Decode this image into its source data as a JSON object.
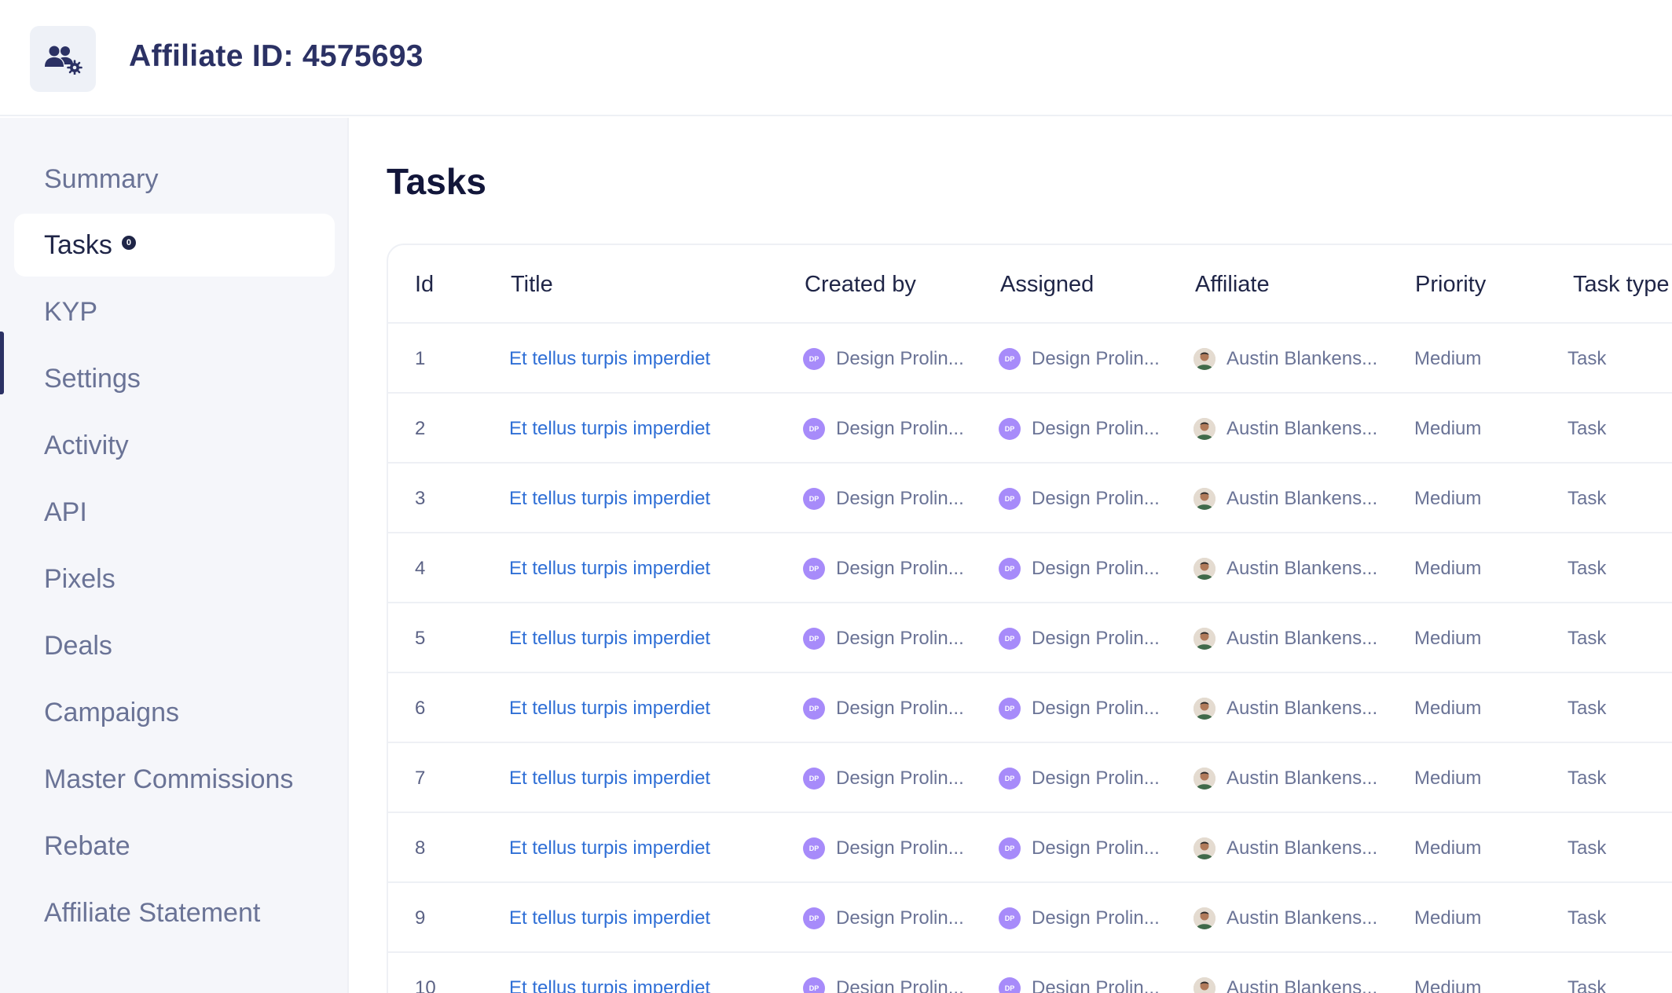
{
  "header": {
    "title": "Affiliate ID: 4575693",
    "icon": "users-gear-icon"
  },
  "sidebar": {
    "items": [
      {
        "label": "Summary"
      },
      {
        "label": "Tasks",
        "badge": "0",
        "active": true
      },
      {
        "label": "KYP"
      },
      {
        "label": "Settings"
      },
      {
        "label": "Activity"
      },
      {
        "label": "API"
      },
      {
        "label": "Pixels"
      },
      {
        "label": "Deals"
      },
      {
        "label": "Campaigns"
      },
      {
        "label": "Master Commissions"
      },
      {
        "label": "Rebate"
      },
      {
        "label": "Affiliate Statement"
      }
    ]
  },
  "main": {
    "title": "Tasks",
    "table": {
      "columns": [
        "Id",
        "Title",
        "Created by",
        "Assigned",
        "Affiliate",
        "Priority",
        "Task type"
      ],
      "avatar_initials": "DP",
      "rows": [
        {
          "id": "1",
          "title": "Et tellus turpis imperdiet",
          "created_by": "Design Prolin...",
          "assigned": "Design Prolin...",
          "affiliate": "Austin Blankens...",
          "priority": "Medium",
          "task_type": "Task"
        },
        {
          "id": "2",
          "title": "Et tellus turpis imperdiet",
          "created_by": "Design Prolin...",
          "assigned": "Design Prolin...",
          "affiliate": "Austin Blankens...",
          "priority": "Medium",
          "task_type": "Task"
        },
        {
          "id": "3",
          "title": "Et tellus turpis imperdiet",
          "created_by": "Design Prolin...",
          "assigned": "Design Prolin...",
          "affiliate": "Austin Blankens...",
          "priority": "Medium",
          "task_type": "Task"
        },
        {
          "id": "4",
          "title": "Et tellus turpis imperdiet",
          "created_by": "Design Prolin...",
          "assigned": "Design Prolin...",
          "affiliate": "Austin Blankens...",
          "priority": "Medium",
          "task_type": "Task"
        },
        {
          "id": "5",
          "title": "Et tellus turpis imperdiet",
          "created_by": "Design Prolin...",
          "assigned": "Design Prolin...",
          "affiliate": "Austin Blankens...",
          "priority": "Medium",
          "task_type": "Task"
        },
        {
          "id": "6",
          "title": "Et tellus turpis imperdiet",
          "created_by": "Design Prolin...",
          "assigned": "Design Prolin...",
          "affiliate": "Austin Blankens...",
          "priority": "Medium",
          "task_type": "Task"
        },
        {
          "id": "7",
          "title": "Et tellus turpis imperdiet",
          "created_by": "Design Prolin...",
          "assigned": "Design Prolin...",
          "affiliate": "Austin Blankens...",
          "priority": "Medium",
          "task_type": "Task"
        },
        {
          "id": "8",
          "title": "Et tellus turpis imperdiet",
          "created_by": "Design Prolin...",
          "assigned": "Design Prolin...",
          "affiliate": "Austin Blankens...",
          "priority": "Medium",
          "task_type": "Task"
        },
        {
          "id": "9",
          "title": "Et tellus turpis imperdiet",
          "created_by": "Design Prolin...",
          "assigned": "Design Prolin...",
          "affiliate": "Austin Blankens...",
          "priority": "Medium",
          "task_type": "Task"
        },
        {
          "id": "10",
          "title": "Et tellus turpis imperdiet",
          "created_by": "Design Prolin...",
          "assigned": "Design Prolin...",
          "affiliate": "Austin Blankens...",
          "priority": "Medium",
          "task_type": "Task"
        }
      ]
    }
  },
  "colors": {
    "accent": "#2b3164",
    "link": "#2f6fd6",
    "avatar_purple": "#a78bfa",
    "sidebar_bg": "#f5f6fa"
  }
}
